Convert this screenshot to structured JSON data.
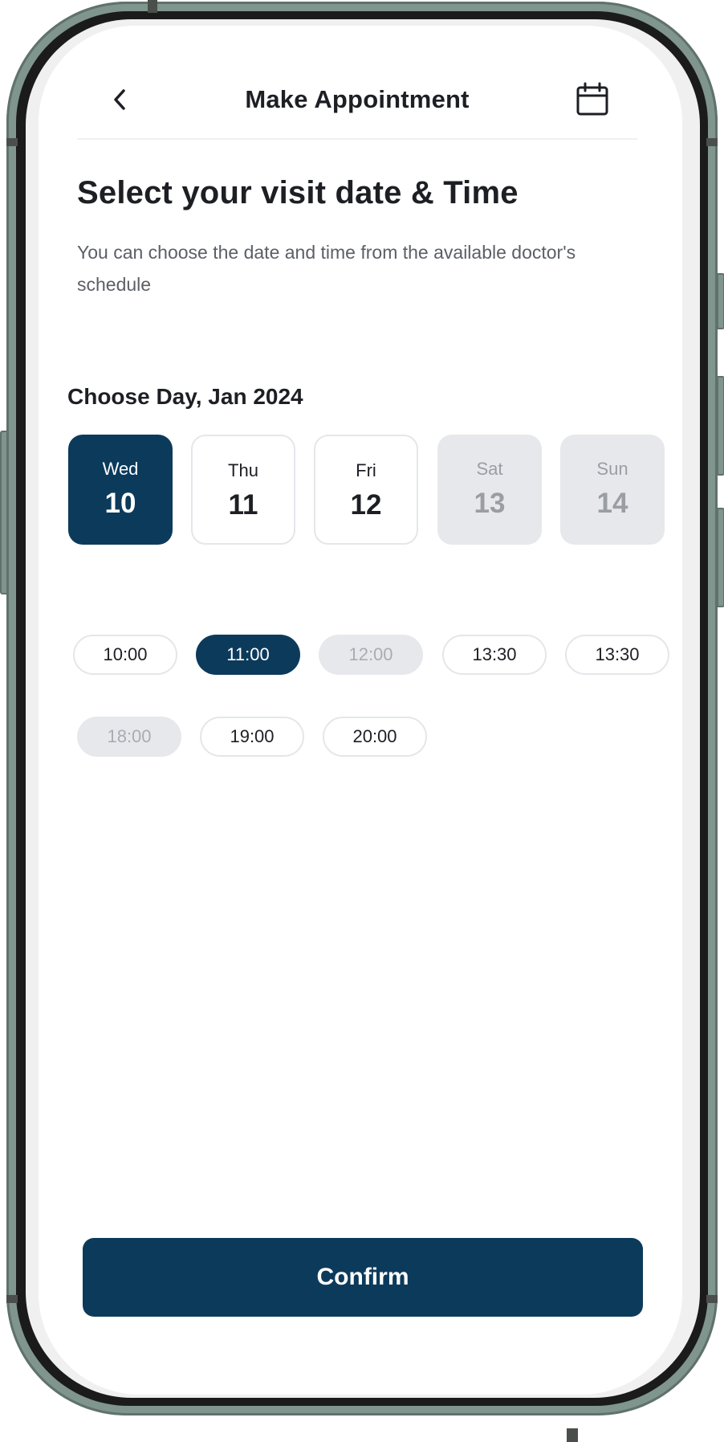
{
  "header": {
    "title": "Make Appointment",
    "back_icon": "chevron-left-icon",
    "calendar_icon": "calendar-icon"
  },
  "heading": "Select your visit date & Time",
  "subtext": "You can choose the date and time from the available doctor's schedule",
  "day_section": {
    "label": "Choose Day, Jan  2024"
  },
  "days": [
    {
      "name": "Wed",
      "num": "10",
      "state": "selected"
    },
    {
      "name": "Thu",
      "num": "11",
      "state": "available"
    },
    {
      "name": "Fri",
      "num": "12",
      "state": "available"
    },
    {
      "name": "Sat",
      "num": "13",
      "state": "disabled"
    },
    {
      "name": "Sun",
      "num": "14",
      "state": "disabled"
    }
  ],
  "slots": [
    {
      "time": "10:00",
      "state": "available"
    },
    {
      "time": "11:00",
      "state": "selected"
    },
    {
      "time": "12:00",
      "state": "disabled"
    },
    {
      "time": "13:30",
      "state": "available"
    },
    {
      "time": "13:30",
      "state": "available"
    },
    {
      "time": "18:00",
      "state": "disabled"
    },
    {
      "time": "19:00",
      "state": "available"
    },
    {
      "time": "20:00",
      "state": "available"
    }
  ],
  "confirm_label": "Confirm",
  "colors": {
    "primary": "#0c3a5b",
    "disabled": "#e7e8eb",
    "frame": "#7f958d"
  }
}
